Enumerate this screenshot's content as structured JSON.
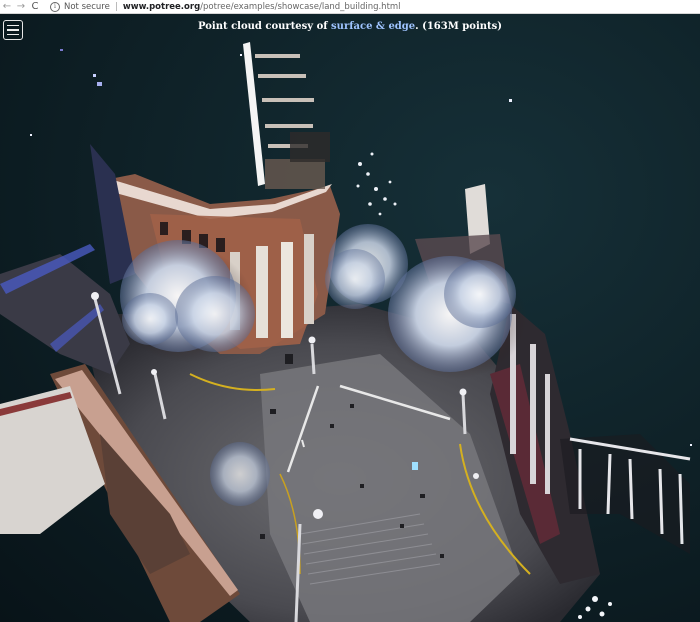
{
  "browser": {
    "back_icon": "←",
    "forward_icon": "→",
    "reload_icon": "C",
    "security_label": "Not secure",
    "url_host": "www.potree.org",
    "url_path": "/potree/examples/showcase/land_building.html"
  },
  "viewer": {
    "credit_prefix": "Point cloud courtesy of ",
    "credit_link": "surface & edge",
    "credit_suffix": ". (163M points)"
  },
  "colors": {
    "background": "#0d1c22",
    "link": "#9fc4ff"
  }
}
